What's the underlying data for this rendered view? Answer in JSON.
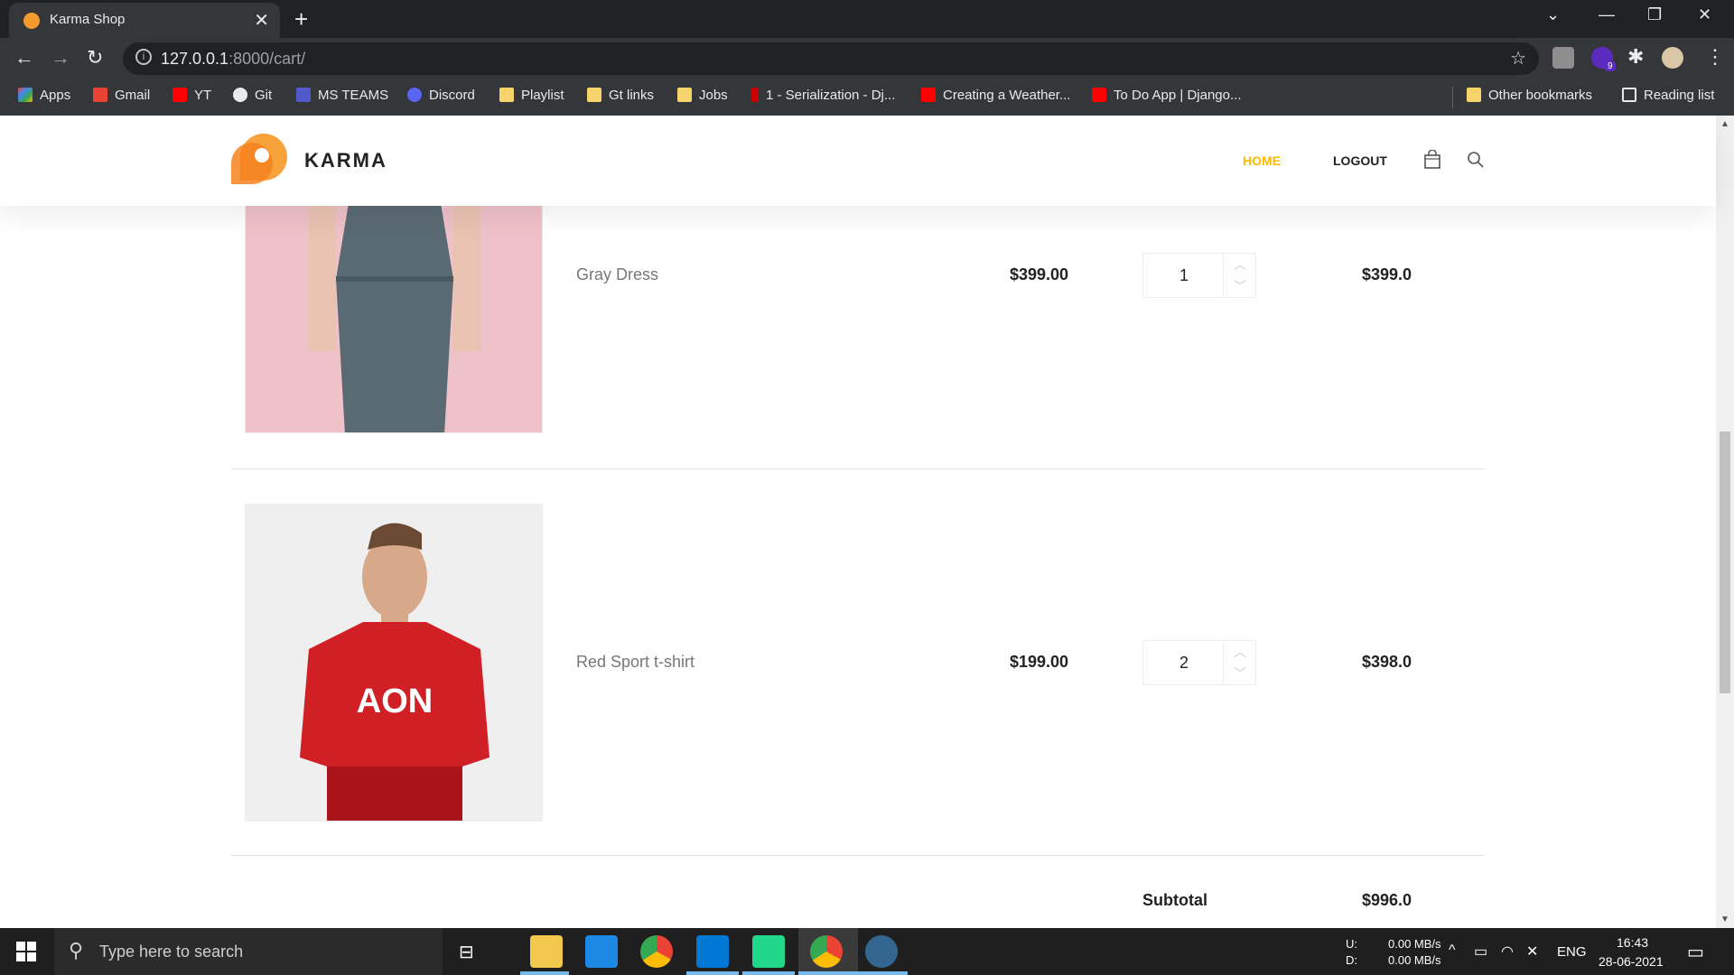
{
  "browser": {
    "tab_title": "Karma Shop",
    "tab_close": "✕",
    "new_tab": "+",
    "url_host": "127.0.0.1",
    "url_path": ":8000/cart/",
    "bookmarks": [
      {
        "label": "Apps"
      },
      {
        "label": "Gmail"
      },
      {
        "label": "YT"
      },
      {
        "label": "Git"
      },
      {
        "label": "MS TEAMS"
      },
      {
        "label": "Discord"
      },
      {
        "label": "Playlist"
      },
      {
        "label": "Gt links"
      },
      {
        "label": "Jobs"
      },
      {
        "label": "1 - Serialization - Dj..."
      },
      {
        "label": "Creating a Weather..."
      },
      {
        "label": "To Do App | Django..."
      }
    ],
    "other_bookmarks": "Other bookmarks",
    "reading_list": "Reading list",
    "extension_badge": "9"
  },
  "site": {
    "logo_text": "KARMA",
    "nav_home": "HOME",
    "nav_logout": "LOGOUT",
    "accent_color": "#ffba00"
  },
  "cart": {
    "items": [
      {
        "name": "Gray Dress",
        "price": "$399.00",
        "quantity": "1",
        "total": "$399.0"
      },
      {
        "name": "Red Sport t-shirt",
        "price": "$199.00",
        "quantity": "2",
        "total": "$398.0"
      }
    ],
    "subtotal_label": "Subtotal",
    "subtotal_value": "$996.0"
  },
  "taskbar": {
    "search_placeholder": "Type here to search",
    "net_u_label": "U:",
    "net_d_label": "D:",
    "net_u_value": "0.00 MB/s",
    "net_d_value": "0.00 MB/s",
    "language": "ENG",
    "time": "16:43",
    "date": "28-06-2021"
  }
}
